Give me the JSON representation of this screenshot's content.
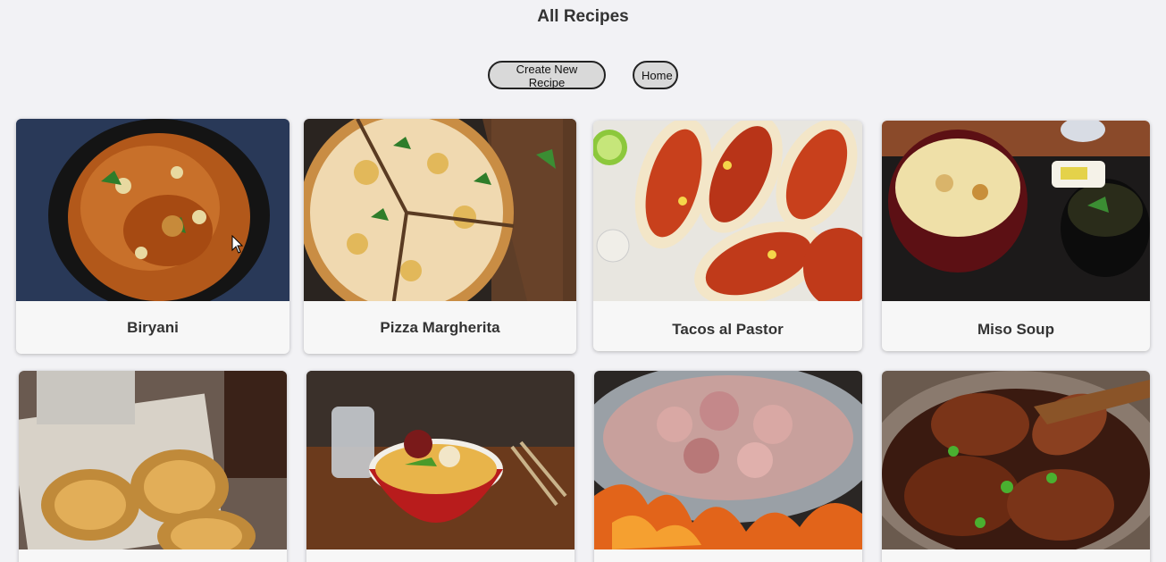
{
  "header": {
    "title": "All Recipes"
  },
  "actions": {
    "create_label": "Create New Recipe",
    "home_label": "Home"
  },
  "recipes": [
    {
      "name": "Biryani",
      "image": "biryani-photo"
    },
    {
      "name": "Pizza Margherita",
      "image": "pizza-photo"
    },
    {
      "name": "Tacos al Pastor",
      "image": "tacos-photo"
    },
    {
      "name": "Miso Soup",
      "image": "miso-soup-photo"
    },
    {
      "name": "",
      "image": "croissants-photo"
    },
    {
      "name": "",
      "image": "ramen-photo"
    },
    {
      "name": "",
      "image": "meat-wok-photo"
    },
    {
      "name": "",
      "image": "braised-chicken-photo"
    }
  ],
  "colors": {
    "background": "#f2f2f5",
    "button": "#d9d9d9",
    "card": "#f7f7f7"
  }
}
